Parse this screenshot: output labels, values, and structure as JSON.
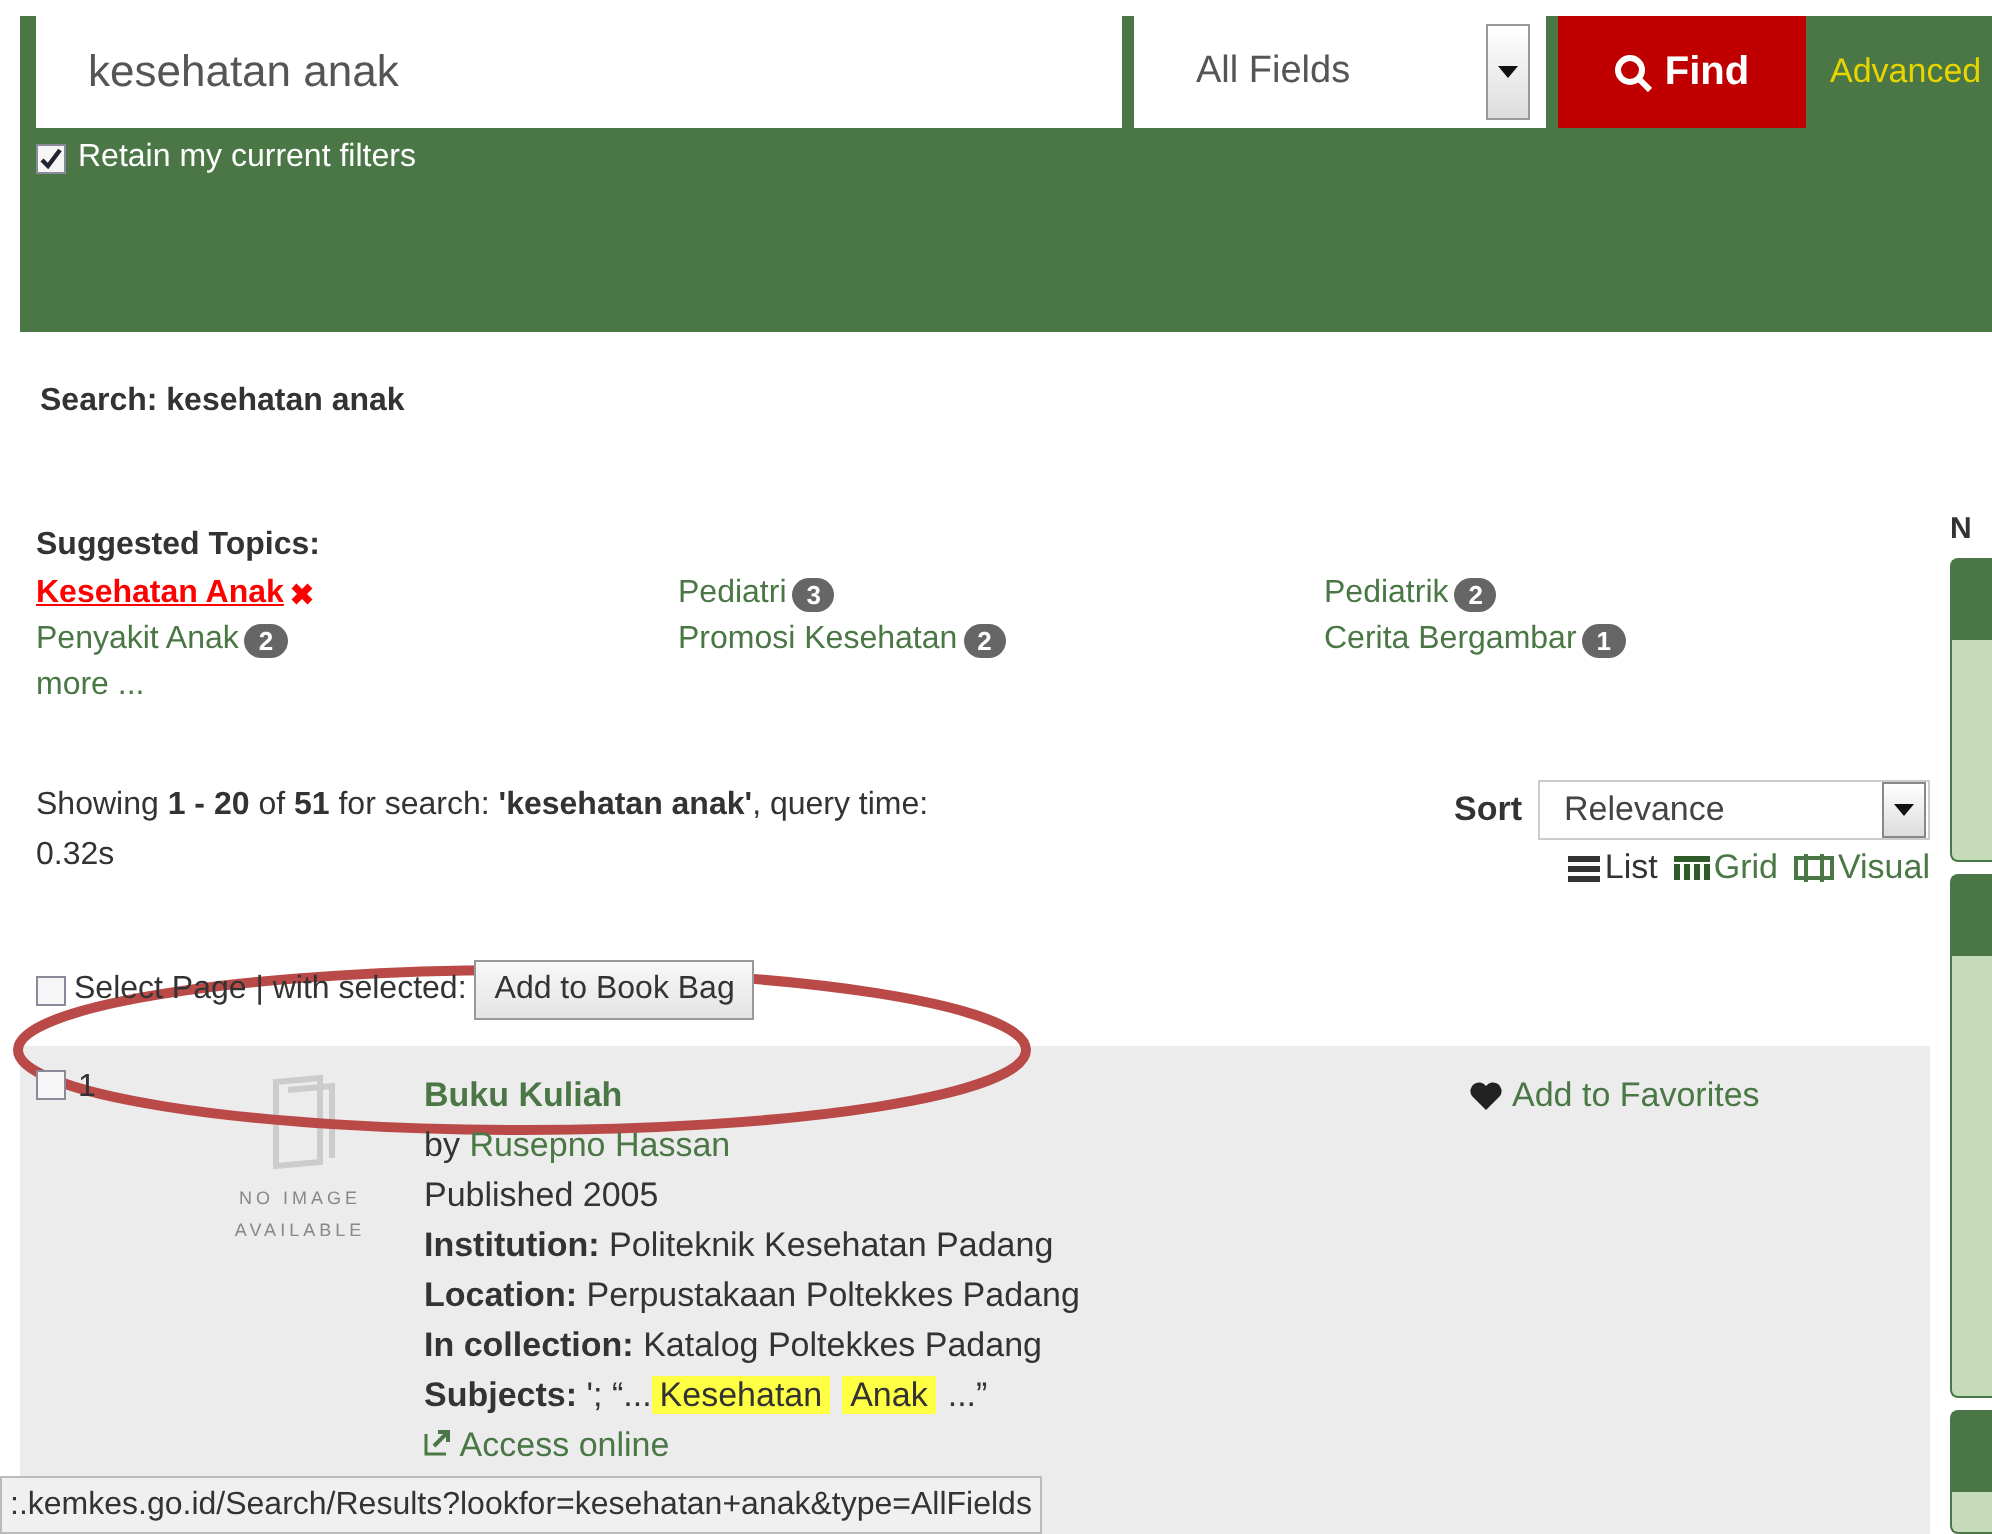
{
  "search": {
    "query": "kesehatan anak",
    "field": "All Fields",
    "find_label": "Find",
    "advanced_link": "Advanced",
    "retain_filters": {
      "label": "Retain my current filters",
      "checked": true
    }
  },
  "search_heading": "Search: kesehatan anak",
  "suggested_topics": {
    "title": "Suggested Topics:",
    "more": "more ...",
    "items": [
      {
        "label": "Kesehatan Anak",
        "selected": true
      },
      {
        "label": "Pediatri",
        "count": "3",
        "selected": false
      },
      {
        "label": "Pediatrik",
        "count": "2",
        "selected": false
      },
      {
        "label": "Penyakit Anak",
        "count": "2",
        "selected": false
      },
      {
        "label": "Promosi Kesehatan",
        "count": "2",
        "selected": false
      },
      {
        "label": "Cerita Bergambar",
        "count": "1",
        "selected": false
      }
    ]
  },
  "results_summary": "Showing **1 - 20** of **51** for search: **'kesehatan anak'**, query time: 0.32s",
  "sort": {
    "label": "Sort",
    "value": "Relevance"
  },
  "views": [
    {
      "label": "List",
      "kind": "list",
      "selected": true
    },
    {
      "label": "Grid",
      "kind": "grid",
      "selected": false
    },
    {
      "label": "Visual",
      "kind": "visual",
      "selected": false
    }
  ],
  "select_page": {
    "label": "Select Page | with selected:",
    "checked": false
  },
  "add_to_book_bag": "Add to Book Bag",
  "results": [
    {
      "number": "1",
      "checked": false,
      "title": "Buku Kuliah",
      "no_image_text": "NO IMAGE AVAILABLE",
      "author_prefix": "by",
      "author": "Rusepno Hassan",
      "published": "Published 2005",
      "fields": [
        {
          "label": "Institution:",
          "value": "Politeknik Kesehatan Padang"
        },
        {
          "label": "Location:",
          "value": "Perpustakaan Poltekkes Padang"
        },
        {
          "label": "In collection:",
          "value": "Katalog Poltekkes Padang"
        }
      ],
      "subjects_label": "Subjects:",
      "subjects": [
        {
          "text": "'; “...",
          "highlight": false
        },
        {
          "text": "Kesehatan",
          "highlight": true
        },
        {
          "text": "Anak",
          "highlight": true
        },
        {
          "text": "...”",
          "highlight": false
        }
      ],
      "access_link": "Access online",
      "favorites": "Add to Favorites"
    }
  ],
  "sidebar": {
    "heading": "N"
  },
  "status_url": ":.kemkes.go.id/Search/Results?lookfor=kesehatan+anak&type=AllFields",
  "annotations": [
    {
      "kind": "ellipse",
      "color": "#b94a48"
    }
  ]
}
